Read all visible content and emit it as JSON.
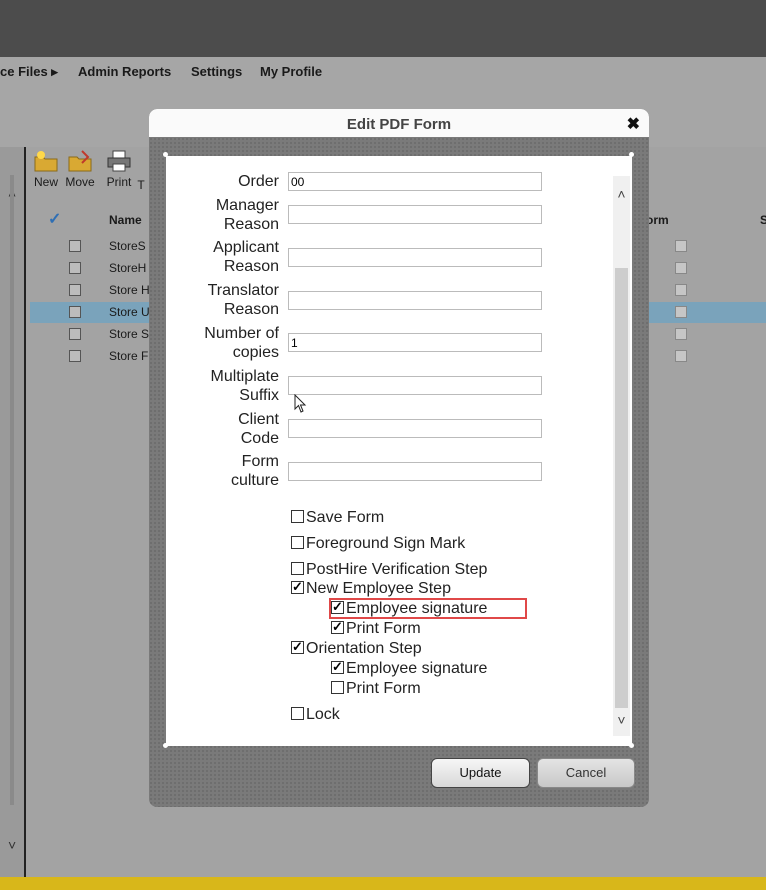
{
  "menu": {
    "items": [
      {
        "label": "ce Files ▸"
      },
      {
        "label": "Admin Reports"
      },
      {
        "label": "Settings"
      },
      {
        "label": "My Profile"
      }
    ]
  },
  "toolbar": {
    "new_label": "New",
    "move_label": "Move",
    "print_label": "Print",
    "extra_label": "T"
  },
  "grid": {
    "check_symbol": "✓",
    "name_header": "Name",
    "form_header": "orm",
    "s_header": "S",
    "rows": [
      {
        "name": "StoreS"
      },
      {
        "name": "StoreH"
      },
      {
        "name": "Store H"
      },
      {
        "name": "Store U"
      },
      {
        "name": "Store S"
      },
      {
        "name": "Store F"
      }
    ]
  },
  "dialog": {
    "title": "Edit PDF Form",
    "close_symbol": "✖",
    "fields": [
      {
        "label_line1": "Order",
        "label_line2": "",
        "value": "00"
      },
      {
        "label_line1": "Manager",
        "label_line2": "Reason",
        "value": ""
      },
      {
        "label_line1": "Applicant",
        "label_line2": "Reason",
        "value": ""
      },
      {
        "label_line1": "Translator",
        "label_line2": "Reason",
        "value": ""
      },
      {
        "label_line1": "Number of",
        "label_line2": "copies",
        "value": "1"
      },
      {
        "label_line1": "Multiplate",
        "label_line2": "Suffix",
        "value": ""
      },
      {
        "label_line1": "Client",
        "label_line2": "Code",
        "value": ""
      },
      {
        "label_line1": "Form",
        "label_line2": "culture",
        "value": ""
      }
    ],
    "checkboxes": [
      {
        "label": "Save Form",
        "checked": false
      },
      {
        "label": "Foreground Sign Mark",
        "checked": false
      },
      {
        "label": "PostHire Verification Step",
        "checked": false
      },
      {
        "label": "New Employee Step",
        "checked": true
      },
      {
        "label": "Employee signature",
        "checked": true
      },
      {
        "label": "Print Form",
        "checked": true
      },
      {
        "label": "Orientation Step",
        "checked": true
      },
      {
        "label": "Employee signature",
        "checked": true
      },
      {
        "label": "Print Form",
        "checked": false
      },
      {
        "label": "Lock",
        "checked": false
      }
    ],
    "update_label": "Update",
    "cancel_label": "Cancel"
  },
  "colors": {
    "topbar": "#4c4c4c",
    "selected_row": "#7aa3bb",
    "highlight_outline": "#e04848",
    "bottom_bar": "#d8b71a"
  }
}
